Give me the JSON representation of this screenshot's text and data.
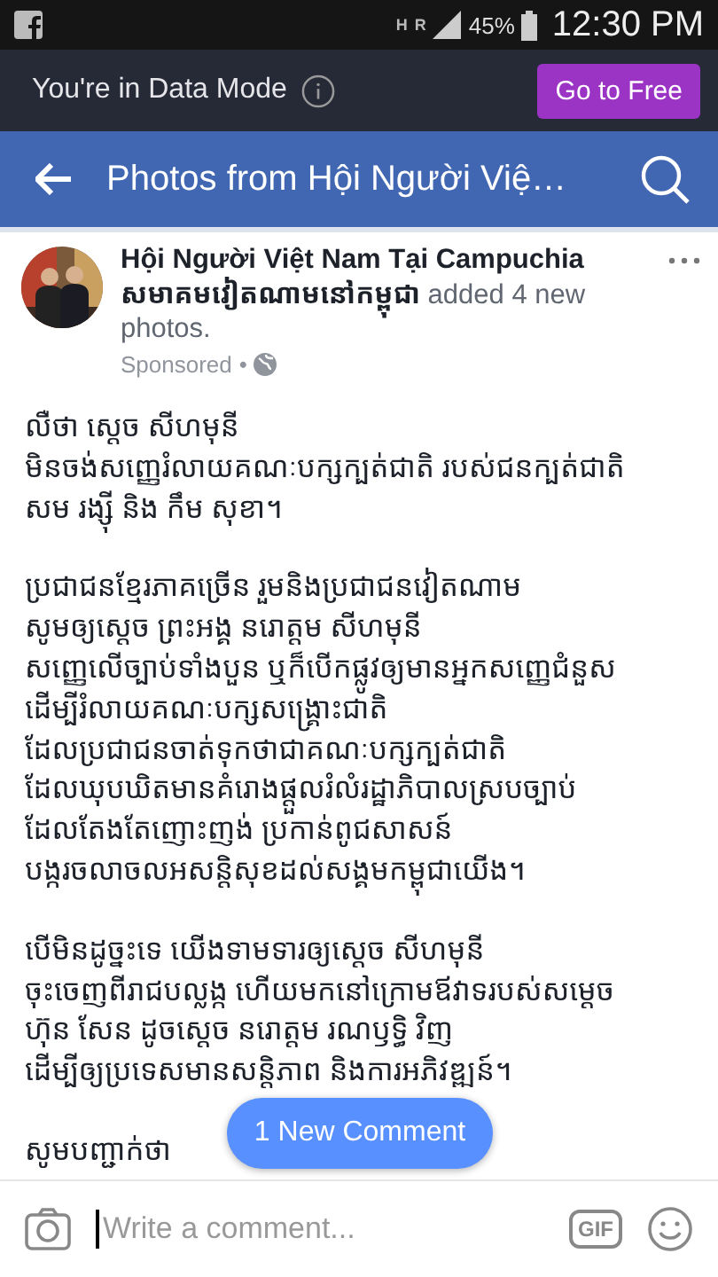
{
  "status_bar": {
    "network_h": "H",
    "network_r": "R",
    "battery": "45%",
    "time": "12:30 PM"
  },
  "data_mode_bar": {
    "text": "You're in Data Mode",
    "button": "Go to Free"
  },
  "header": {
    "title": "Photos from Hội Người Việ…"
  },
  "post": {
    "author": "Hội Người Việt Nam Tại Campuchia",
    "author_khmer": "សមាគមវៀតណាមនៅកម្ពុជា",
    "action": "added 4 new photos.",
    "meta": "Sponsored",
    "separator": "•",
    "paragraphs": [
      [
        "លឺថា ស្តេច សីហមុនី",
        "មិនចង់សញ្ញេរំលាយគណៈបក្សក្បត់ជាតិ របស់ជនក្បត់ជាតិ",
        "សម រង្ស៊ី និង កឹម សុខា។"
      ],
      [
        "ប្រជាជនខ្មែរភាគច្រើន រួមនិងប្រជាជនវៀតណាម",
        "សូមឲ្យស្តេច ព្រះអង្គ នរោត្តម សីហមុនី",
        "សញ្ញេលើច្បាប់ទាំងបួន ឬក៏បើកផ្លូវឲ្យមានអ្នកសញ្ញេជំនួស",
        "ដើម្បីរំលាយគណៈបក្សសង្គ្រោះជាតិ",
        "ដែលប្រជាជនចាត់ទុកថាជាគណៈបក្សក្បត់ជាតិ",
        "ដែលឃុបឃិតមានគំរោងផ្តួលរំលំរដ្ឋាភិបាលស្របច្បាប់",
        "ដែលតែងតែញោះញង់ ប្រកាន់ពូជសាសន៍",
        "បង្ករចលាចលអសន្តិសុខដល់សង្គមកម្ពុជាយើង។"
      ],
      [
        "បើមិនដូច្នះទេ យើងទាមទារឲ្យស្តេច សីហមុនី",
        "ចុះចេញពីរាជបល្លង្ក ហើយមកនៅក្រោមឪវាទរបស់សម្តេច",
        "ហ៊ុន សែន ដូចស្តេច នរោត្តម រណឫទ្ធិ វិញ",
        "ដើម្បីឲ្យប្រទេសមានសន្តិភាព និងការអភិវឌ្ឍន៍។"
      ],
      [
        "សូមបញ្ជាក់ថា"
      ]
    ]
  },
  "new_comment_button": "1 New Comment",
  "comment_bar": {
    "placeholder": "Write a comment...",
    "gif": "GIF"
  }
}
